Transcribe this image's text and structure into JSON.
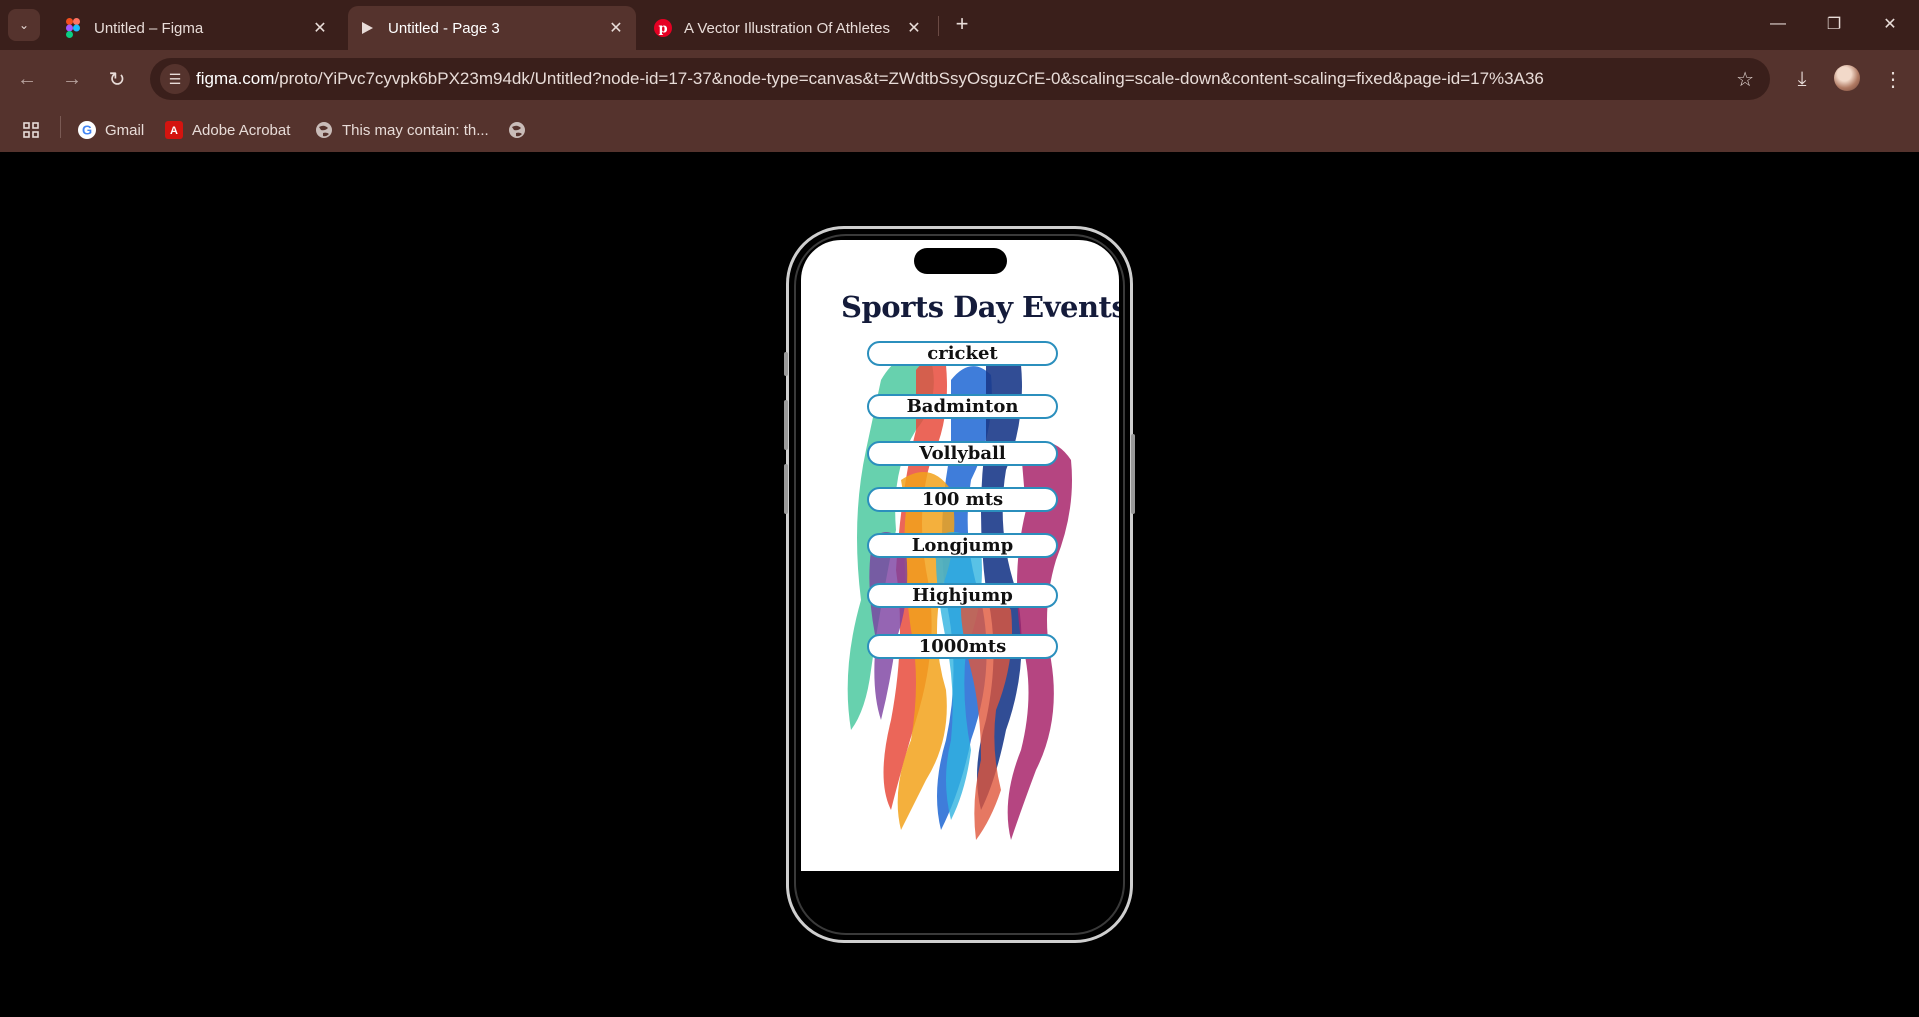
{
  "browser": {
    "tabs": [
      {
        "title": "Untitled – Figma",
        "icon": "figma-icon"
      },
      {
        "title": "Untitled - Page 3",
        "icon": "play-icon"
      },
      {
        "title": "A Vector Illustration Of Athletes",
        "icon": "pinterest-icon"
      }
    ],
    "url_host": "figma.com",
    "url_path": "/proto/YiPvc7cyvpk6bPX23m94dk/Untitled?node-id=17-37&node-type=canvas&t=ZWdtbSsyOsguzCrE-0&scaling=scale-down&content-scaling=fixed&page-id=17%3A36",
    "bookmarks": [
      {
        "label": "Gmail",
        "icon": "google-icon"
      },
      {
        "label": "Adobe Acrobat",
        "icon": "acrobat-icon"
      },
      {
        "label": "This may contain: th...",
        "icon": "globe-icon"
      },
      {
        "label": "",
        "icon": "globe-icon"
      }
    ]
  },
  "prototype": {
    "title": "Sports Day Events",
    "events": [
      "cricket",
      "Badminton",
      "Vollyball",
      "100 mts",
      "Longjump",
      "Highjump",
      "1000mts"
    ]
  },
  "colors": {
    "tabstrip": "#3a1f1b",
    "toolbar": "#55332d",
    "title": "#141b3a",
    "event_border": "#2b8fbd"
  }
}
